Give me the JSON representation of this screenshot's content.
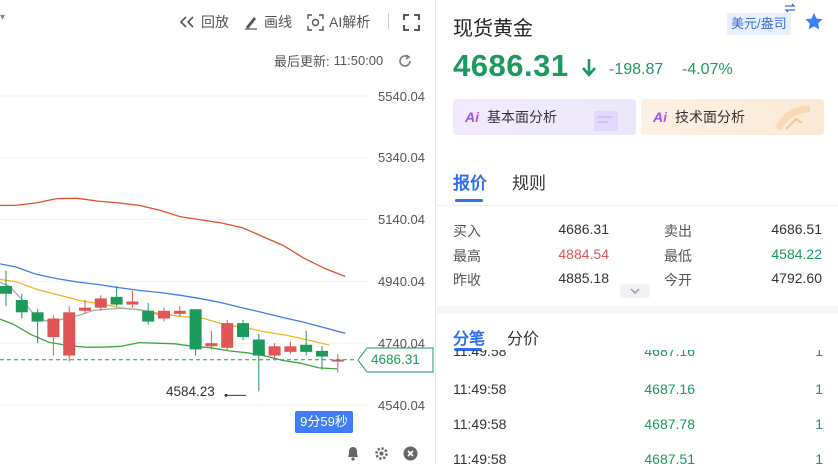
{
  "toolbar": {
    "replay_label": "回放",
    "draw_label": "画线",
    "ai_analysis_label": "AI解析"
  },
  "update": {
    "label": "最后更新:",
    "time": "11:50:00"
  },
  "chart_data": {
    "type": "candlestick",
    "y_ticks": [
      "5540.04",
      "5340.04",
      "5140.04",
      "4940.04",
      "4740.04",
      "4540.04"
    ],
    "ylim": [
      4480.04,
      5600.04
    ],
    "candles": [
      {
        "open": 4925,
        "close": 4900,
        "high": 4975,
        "low": 4860
      },
      {
        "open": 4880,
        "close": 4840,
        "high": 4900,
        "low": 4820
      },
      {
        "open": 4840,
        "close": 4810,
        "high": 4850,
        "low": 4740
      },
      {
        "open": 4760,
        "close": 4820,
        "high": 4830,
        "low": 4700
      },
      {
        "open": 4700,
        "close": 4840,
        "high": 4860,
        "low": 4680
      },
      {
        "open": 4845,
        "close": 4855,
        "high": 4880,
        "low": 4835
      },
      {
        "open": 4855,
        "close": 4885,
        "high": 4895,
        "low": 4845
      },
      {
        "open": 4890,
        "close": 4865,
        "high": 4925,
        "low": 4860
      },
      {
        "open": 4865,
        "close": 4875,
        "high": 4910,
        "low": 4855
      },
      {
        "open": 4845,
        "close": 4810,
        "high": 4870,
        "low": 4800
      },
      {
        "open": 4820,
        "close": 4845,
        "high": 4855,
        "low": 4810
      },
      {
        "open": 4835,
        "close": 4845,
        "high": 4860,
        "low": 4825
      },
      {
        "open": 4850,
        "close": 4720,
        "high": 4850,
        "low": 4700
      },
      {
        "open": 4730,
        "close": 4740,
        "high": 4780,
        "low": 4720
      },
      {
        "open": 4725,
        "close": 4805,
        "high": 4815,
        "low": 4715
      },
      {
        "open": 4805,
        "close": 4760,
        "high": 4815,
        "low": 4750
      },
      {
        "open": 4752,
        "close": 4700,
        "high": 4770,
        "low": 4584.23
      },
      {
        "open": 4700,
        "close": 4730,
        "high": 4740,
        "low": 4690
      },
      {
        "open": 4712,
        "close": 4730,
        "high": 4745,
        "low": 4705
      },
      {
        "open": 4735,
        "close": 4712,
        "high": 4780,
        "low": 4700
      },
      {
        "open": 4715,
        "close": 4697,
        "high": 4730,
        "low": 4655
      },
      {
        "open": 4685,
        "close": 4687,
        "high": 4705,
        "low": 4645
      }
    ],
    "ma_lines": [
      {
        "color": "#e0502e",
        "values": [
          5186,
          5186,
          5194,
          5208,
          5209,
          5200,
          5194,
          5186,
          5170,
          5149,
          5139,
          5129,
          5114,
          5085,
          5056,
          5015,
          4982,
          4956
        ]
      },
      {
        "color": "#3d7de8",
        "values": [
          5000,
          4987,
          4963,
          4949,
          4938,
          4930,
          4920,
          4911,
          4904,
          4895,
          4884,
          4871,
          4855,
          4839,
          4823,
          4808,
          4790,
          4772
        ]
      },
      {
        "color": "#f5b324",
        "values": [
          4949,
          4939,
          4914,
          4897,
          4879,
          4868,
          4855,
          4847,
          4835,
          4826,
          4820,
          4800,
          4790,
          4776,
          4765,
          4750,
          4734
        ]
      },
      {
        "color": "#aaaaaa",
        "values": [
          4944,
          4925,
          4878,
          4820,
          4809,
          4820,
          4830,
          4846,
          4850,
          4853,
          4850,
          4844,
          4826
        ]
      },
      {
        "color": "#3aa83a",
        "values": [
          4824,
          4802,
          4768,
          4743,
          4733,
          4727,
          4727,
          4730,
          4742,
          4740,
          4738,
          4730,
          4725,
          4715,
          4709,
          4699,
          4684,
          4675,
          4660,
          4657
        ]
      }
    ],
    "last_price": "4686.31",
    "low_mark": "4584.23"
  },
  "countdown": "9分59秒",
  "symbol": {
    "name": "现货黄金",
    "currency": "美元/盎司",
    "price": "4686.31",
    "change": "-198.87",
    "change_pct": "-4.07%"
  },
  "ai_buttons": {
    "fundamental": "基本面分析",
    "technical": "技术面分析"
  },
  "tabs": {
    "quote": "报价",
    "rules": "规则"
  },
  "quote": {
    "bid_label": "买入",
    "bid": "4686.31",
    "ask_label": "卖出",
    "ask": "4686.51",
    "high_label": "最高",
    "high": "4884.54",
    "low_label": "最低",
    "low": "4584.22",
    "prev_close_label": "昨收",
    "prev_close": "4885.18",
    "open_label": "今开",
    "open": "4792.60"
  },
  "sub_tabs": {
    "ticks": "分笔",
    "price": "分价"
  },
  "ticks": [
    {
      "time": "11:49:58",
      "price": "4687.16",
      "vol": "1"
    },
    {
      "time": "11:49:58",
      "price": "4687.78",
      "vol": "1"
    },
    {
      "time": "11:49:58",
      "price": "4687.51",
      "vol": "1"
    }
  ],
  "colors": {
    "up": "#e05555",
    "down": "#1a9b5c",
    "accent": "#2e6ff2"
  }
}
